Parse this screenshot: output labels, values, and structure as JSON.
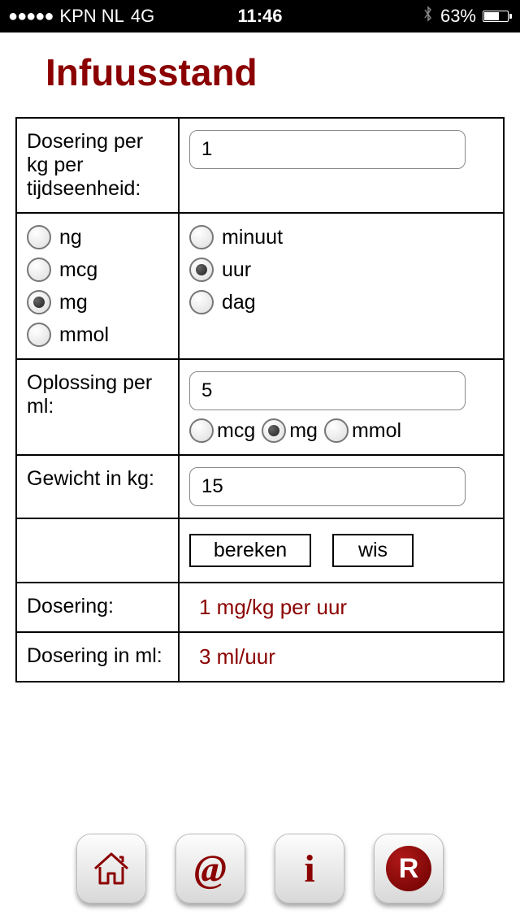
{
  "status": {
    "carrier": "KPN NL",
    "network": "4G",
    "time": "11:46",
    "battery_pct": "63%"
  },
  "title": "Infuusstand",
  "labels": {
    "dosering_per_kg": "Dosering per kg per tijdseenheid:",
    "oplossing": "Oplossing per ml:",
    "gewicht": "Gewicht in kg:",
    "dosering": "Dosering:",
    "dosering_ml": "Dosering in ml:"
  },
  "inputs": {
    "dosering_value": "1",
    "oplossing_value": "5",
    "gewicht_value": "15"
  },
  "unit_options": {
    "mass": [
      "ng",
      "mcg",
      "mg",
      "mmol"
    ],
    "mass_selected": "mg",
    "time": [
      "minuut",
      "uur",
      "dag"
    ],
    "time_selected": "uur",
    "solution": [
      "mcg",
      "mg",
      "mmol"
    ],
    "solution_selected": "mg"
  },
  "buttons": {
    "calculate": "bereken",
    "clear": "wis"
  },
  "results": {
    "dosering": "1 mg/kg per uur",
    "dosering_ml": "3 ml/uur"
  },
  "nav": {
    "home": "home-icon",
    "email": "@",
    "info": "i",
    "r": "R"
  }
}
